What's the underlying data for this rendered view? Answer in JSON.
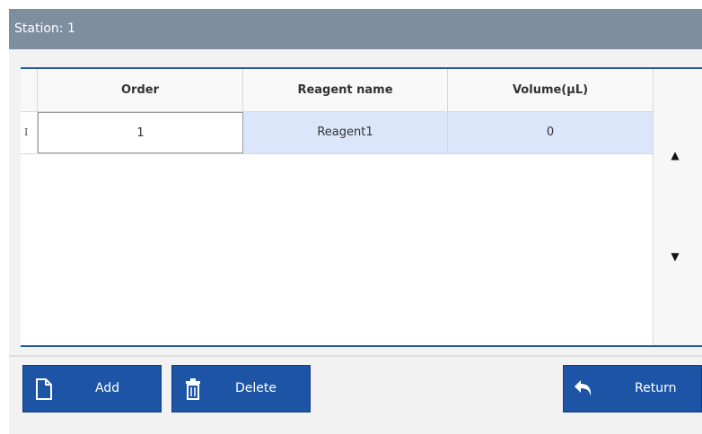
{
  "window": {
    "title": "Station: 1"
  },
  "table": {
    "columns": [
      "Order",
      "Reagent name",
      "Volume(µL)"
    ],
    "rows": [
      {
        "row_header": "I",
        "order": "1",
        "reagent_name": "Reagent1",
        "volume": "0"
      }
    ]
  },
  "scroll": {
    "up_glyph": "▲",
    "down_glyph": "▼"
  },
  "buttons": {
    "add": "Add",
    "delete": "Delete",
    "return": "Return"
  },
  "colors": {
    "accent": "#1d54a6",
    "titlebar": "#7f8e9f",
    "selected_row": "#dbe6fb"
  },
  "icons": {
    "add": "document-icon",
    "delete": "trash-icon",
    "return": "return-arrow-icon"
  }
}
